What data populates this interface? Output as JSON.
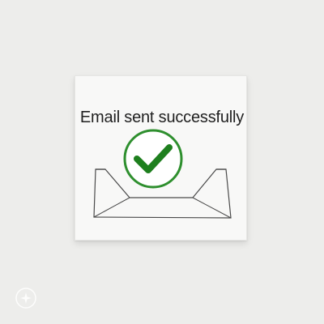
{
  "message": "Email sent successfully",
  "icons": {
    "envelope": "envelope-icon",
    "status": "check-circle-icon",
    "corner": "sparkle-icon"
  },
  "colors": {
    "background": "#ededeb",
    "card": "#f8f8f7",
    "success_green": "#2e8f2e",
    "check_green": "#1e7f1e",
    "text": "#1f1f1f"
  }
}
